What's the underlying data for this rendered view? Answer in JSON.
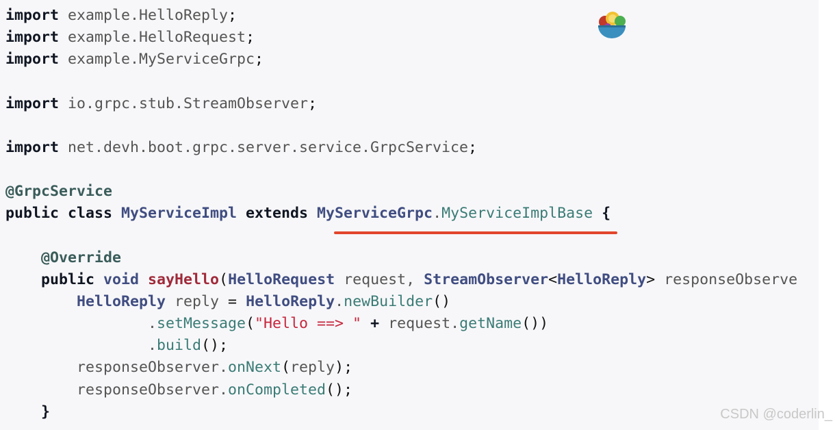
{
  "colors": {
    "background": "#f7f7f9",
    "keyword": "#0f1521",
    "plain": "#545454",
    "type": "#404d81",
    "method": "#3a7b75",
    "method_name": "#a02a3a",
    "string": "#c7253c",
    "annotation": "#3a5c5a",
    "underline": "#e2462c"
  },
  "decorations": {
    "mascot": "salad-bowl-icon"
  },
  "watermark": "CSDN @coderlin_",
  "code": [
    {
      "tokens": [
        {
          "t": "import",
          "c": "kw"
        },
        {
          "t": " example.HelloReply",
          "c": "pl"
        },
        {
          "t": ";",
          "c": "pu"
        }
      ]
    },
    {
      "tokens": [
        {
          "t": "import",
          "c": "kw"
        },
        {
          "t": " example.HelloRequest",
          "c": "pl"
        },
        {
          "t": ";",
          "c": "pu"
        }
      ]
    },
    {
      "tokens": [
        {
          "t": "import",
          "c": "kw"
        },
        {
          "t": " example.MyServiceGrpc",
          "c": "pl"
        },
        {
          "t": ";",
          "c": "pu"
        }
      ]
    },
    {
      "tokens": []
    },
    {
      "tokens": [
        {
          "t": "import",
          "c": "kw"
        },
        {
          "t": " io.grpc.stub.StreamObserver",
          "c": "pl"
        },
        {
          "t": ";",
          "c": "pu"
        }
      ]
    },
    {
      "tokens": []
    },
    {
      "tokens": [
        {
          "t": "import",
          "c": "kw"
        },
        {
          "t": " net.devh.boot.grpc.server.service.GrpcService",
          "c": "pl"
        },
        {
          "t": ";",
          "c": "pu"
        }
      ]
    },
    {
      "tokens": []
    },
    {
      "tokens": [
        {
          "t": "@GrpcService",
          "c": "an"
        }
      ]
    },
    {
      "tokens": [
        {
          "t": "public class ",
          "c": "kw"
        },
        {
          "t": "MyServiceImpl",
          "c": "ty"
        },
        {
          "t": " extends ",
          "c": "kw"
        },
        {
          "t": "MyServiceGrpc",
          "c": "ty"
        },
        {
          "t": ".",
          "c": "pl"
        },
        {
          "t": "MyServiceImplBase",
          "c": "me"
        },
        {
          "t": " {",
          "c": "kw"
        }
      ]
    },
    {
      "tokens": []
    },
    {
      "tokens": [
        {
          "t": "    ",
          "c": "pl"
        },
        {
          "t": "@Override",
          "c": "an"
        }
      ]
    },
    {
      "tokens": [
        {
          "t": "    public ",
          "c": "kw"
        },
        {
          "t": "void ",
          "c": "ty"
        },
        {
          "t": "sayHello",
          "c": "nm"
        },
        {
          "t": "(",
          "c": "pu"
        },
        {
          "t": "HelloRequest",
          "c": "ty"
        },
        {
          "t": " request, ",
          "c": "pl"
        },
        {
          "t": "StreamObserver",
          "c": "ty"
        },
        {
          "t": "<",
          "c": "pu"
        },
        {
          "t": "HelloReply",
          "c": "ty"
        },
        {
          "t": ">",
          "c": "pu"
        },
        {
          "t": " responseObserve",
          "c": "pl"
        }
      ]
    },
    {
      "tokens": [
        {
          "t": "        ",
          "c": "pl"
        },
        {
          "t": "HelloReply",
          "c": "ty"
        },
        {
          "t": " reply ",
          "c": "pl"
        },
        {
          "t": "=",
          "c": "pu"
        },
        {
          "t": " ",
          "c": "pl"
        },
        {
          "t": "HelloReply",
          "c": "ty"
        },
        {
          "t": ".",
          "c": "pl"
        },
        {
          "t": "newBuilder",
          "c": "me"
        },
        {
          "t": "()",
          "c": "pu"
        }
      ]
    },
    {
      "tokens": [
        {
          "t": "                .",
          "c": "pl"
        },
        {
          "t": "setMessage",
          "c": "me"
        },
        {
          "t": "(",
          "c": "pu"
        },
        {
          "t": "\"Hello ==> \"",
          "c": "st"
        },
        {
          "t": " + ",
          "c": "kw"
        },
        {
          "t": "request.",
          "c": "pl"
        },
        {
          "t": "getName",
          "c": "me"
        },
        {
          "t": "())",
          "c": "pu"
        }
      ]
    },
    {
      "tokens": [
        {
          "t": "                .",
          "c": "pl"
        },
        {
          "t": "build",
          "c": "me"
        },
        {
          "t": "();",
          "c": "pu"
        }
      ]
    },
    {
      "tokens": [
        {
          "t": "        responseObserver.",
          "c": "pl"
        },
        {
          "t": "onNext",
          "c": "me"
        },
        {
          "t": "(",
          "c": "pu"
        },
        {
          "t": "reply",
          "c": "pl"
        },
        {
          "t": ");",
          "c": "pu"
        }
      ]
    },
    {
      "tokens": [
        {
          "t": "        responseObserver.",
          "c": "pl"
        },
        {
          "t": "onCompleted",
          "c": "me"
        },
        {
          "t": "();",
          "c": "pu"
        }
      ]
    },
    {
      "tokens": [
        {
          "t": "    }",
          "c": "kw"
        }
      ]
    }
  ]
}
